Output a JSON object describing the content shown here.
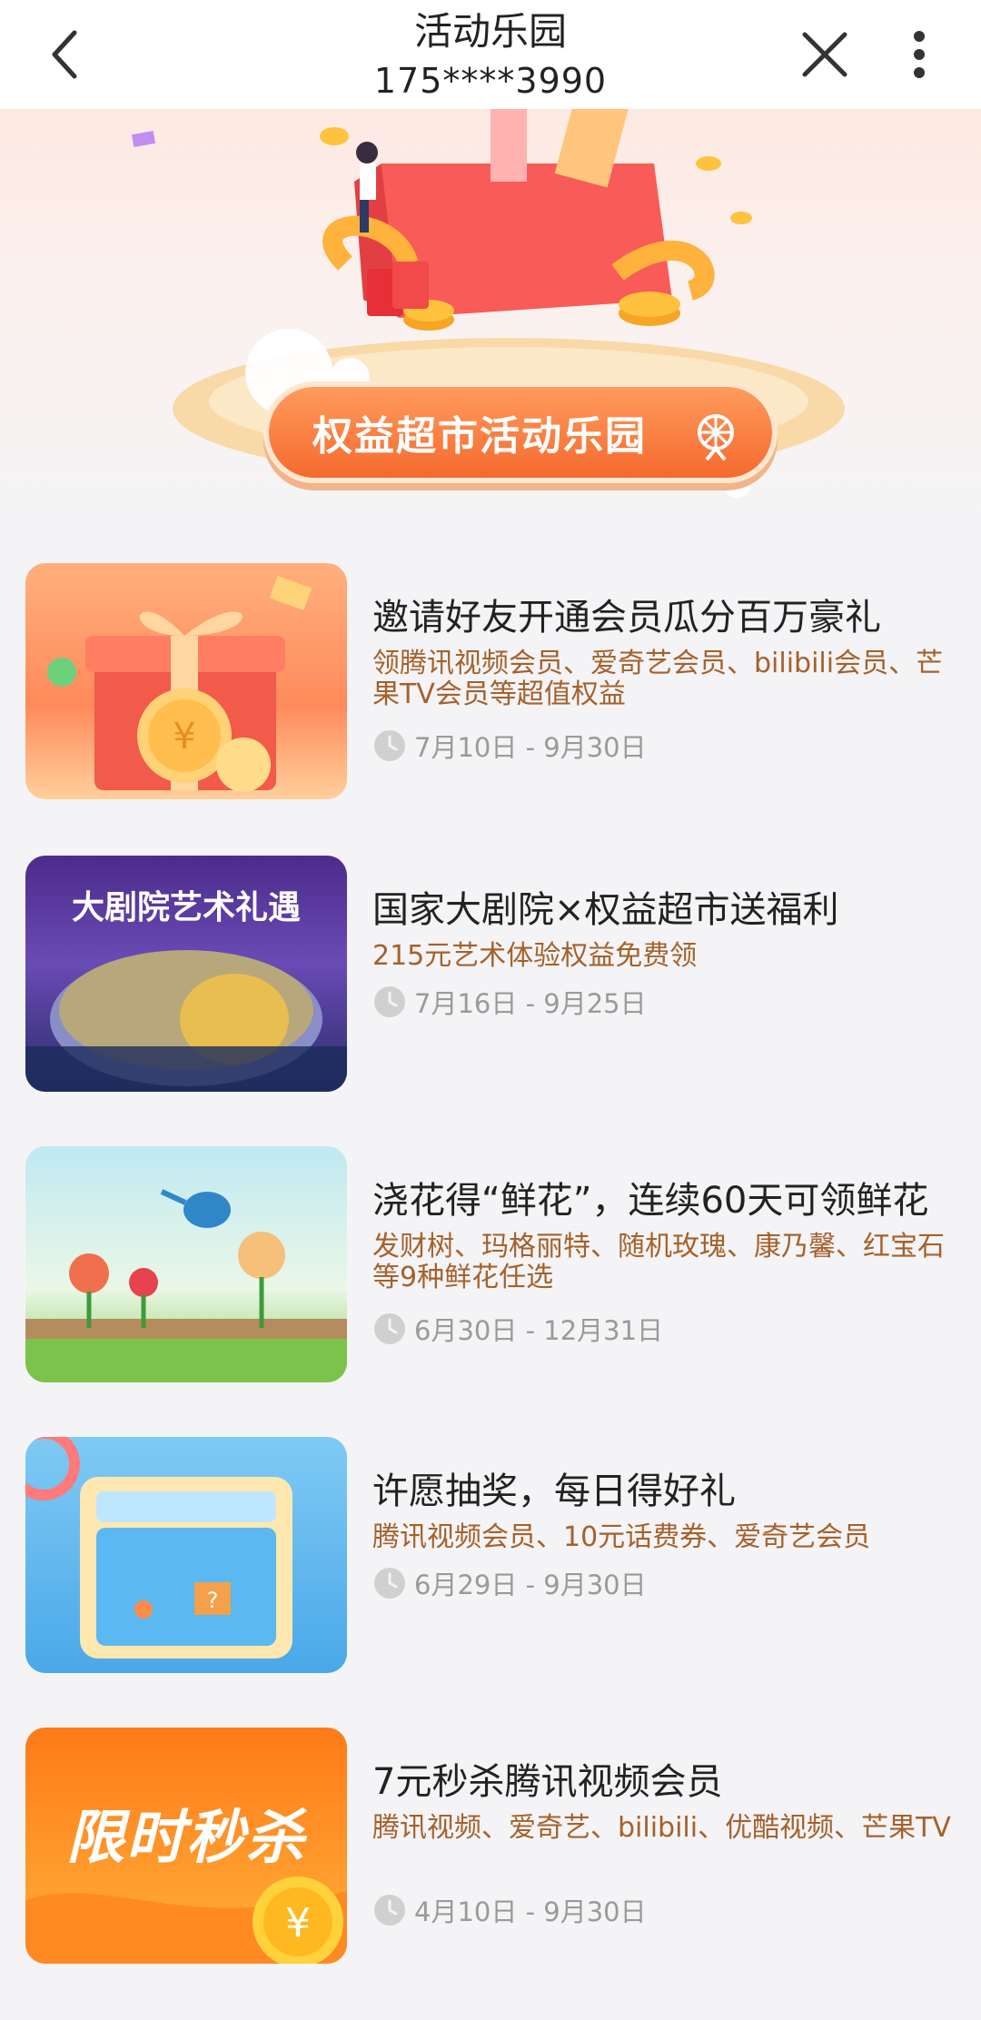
{
  "header": {
    "title": "活动乐园",
    "subtitle": "175****3990"
  },
  "banner": {
    "label": "权益超市活动乐园",
    "big_title": "大剧院艺术礼遇"
  },
  "activities": [
    {
      "title": "邀请好友开通会员瓜分百万豪礼",
      "desc": "领腾讯视频会员、爱奇艺会员、bilibili会员、芒果TV会员等超值权益",
      "date": "7月10日 - 9月30日"
    },
    {
      "title": "国家大剧院×权益超市送福利",
      "desc": "215元艺术体验权益免费领",
      "date": "7月16日 - 9月25日",
      "thumb_text": "大剧院艺术礼遇"
    },
    {
      "title": "浇花得“鲜花”，连续60天可领鲜花",
      "desc": "发财树、玛格丽特、随机玫瑰、康乃馨、红宝石等9种鲜花任选",
      "date": "6月30日 - 12月31日"
    },
    {
      "title": "许愿抽奖，每日得好礼",
      "desc": "腾讯视频会员、10元话费券、爱奇艺会员",
      "date": "6月29日 - 9月30日"
    },
    {
      "title": "7元秒杀腾讯视频会员",
      "desc": "腾讯视频、爱奇艺、bilibili、优酷视频、芒果TV",
      "date": "4月10日 - 9月30日",
      "thumb_text": "限时秒杀"
    }
  ],
  "icons": {
    "back": "chevron-left-icon",
    "close": "close-icon",
    "more": "more-vertical-icon",
    "clock": "clock-icon"
  },
  "colors": {
    "accent_orange": "#f56a2e",
    "desc_brown": "#a5612b",
    "date_gray": "#9a9a9a"
  }
}
